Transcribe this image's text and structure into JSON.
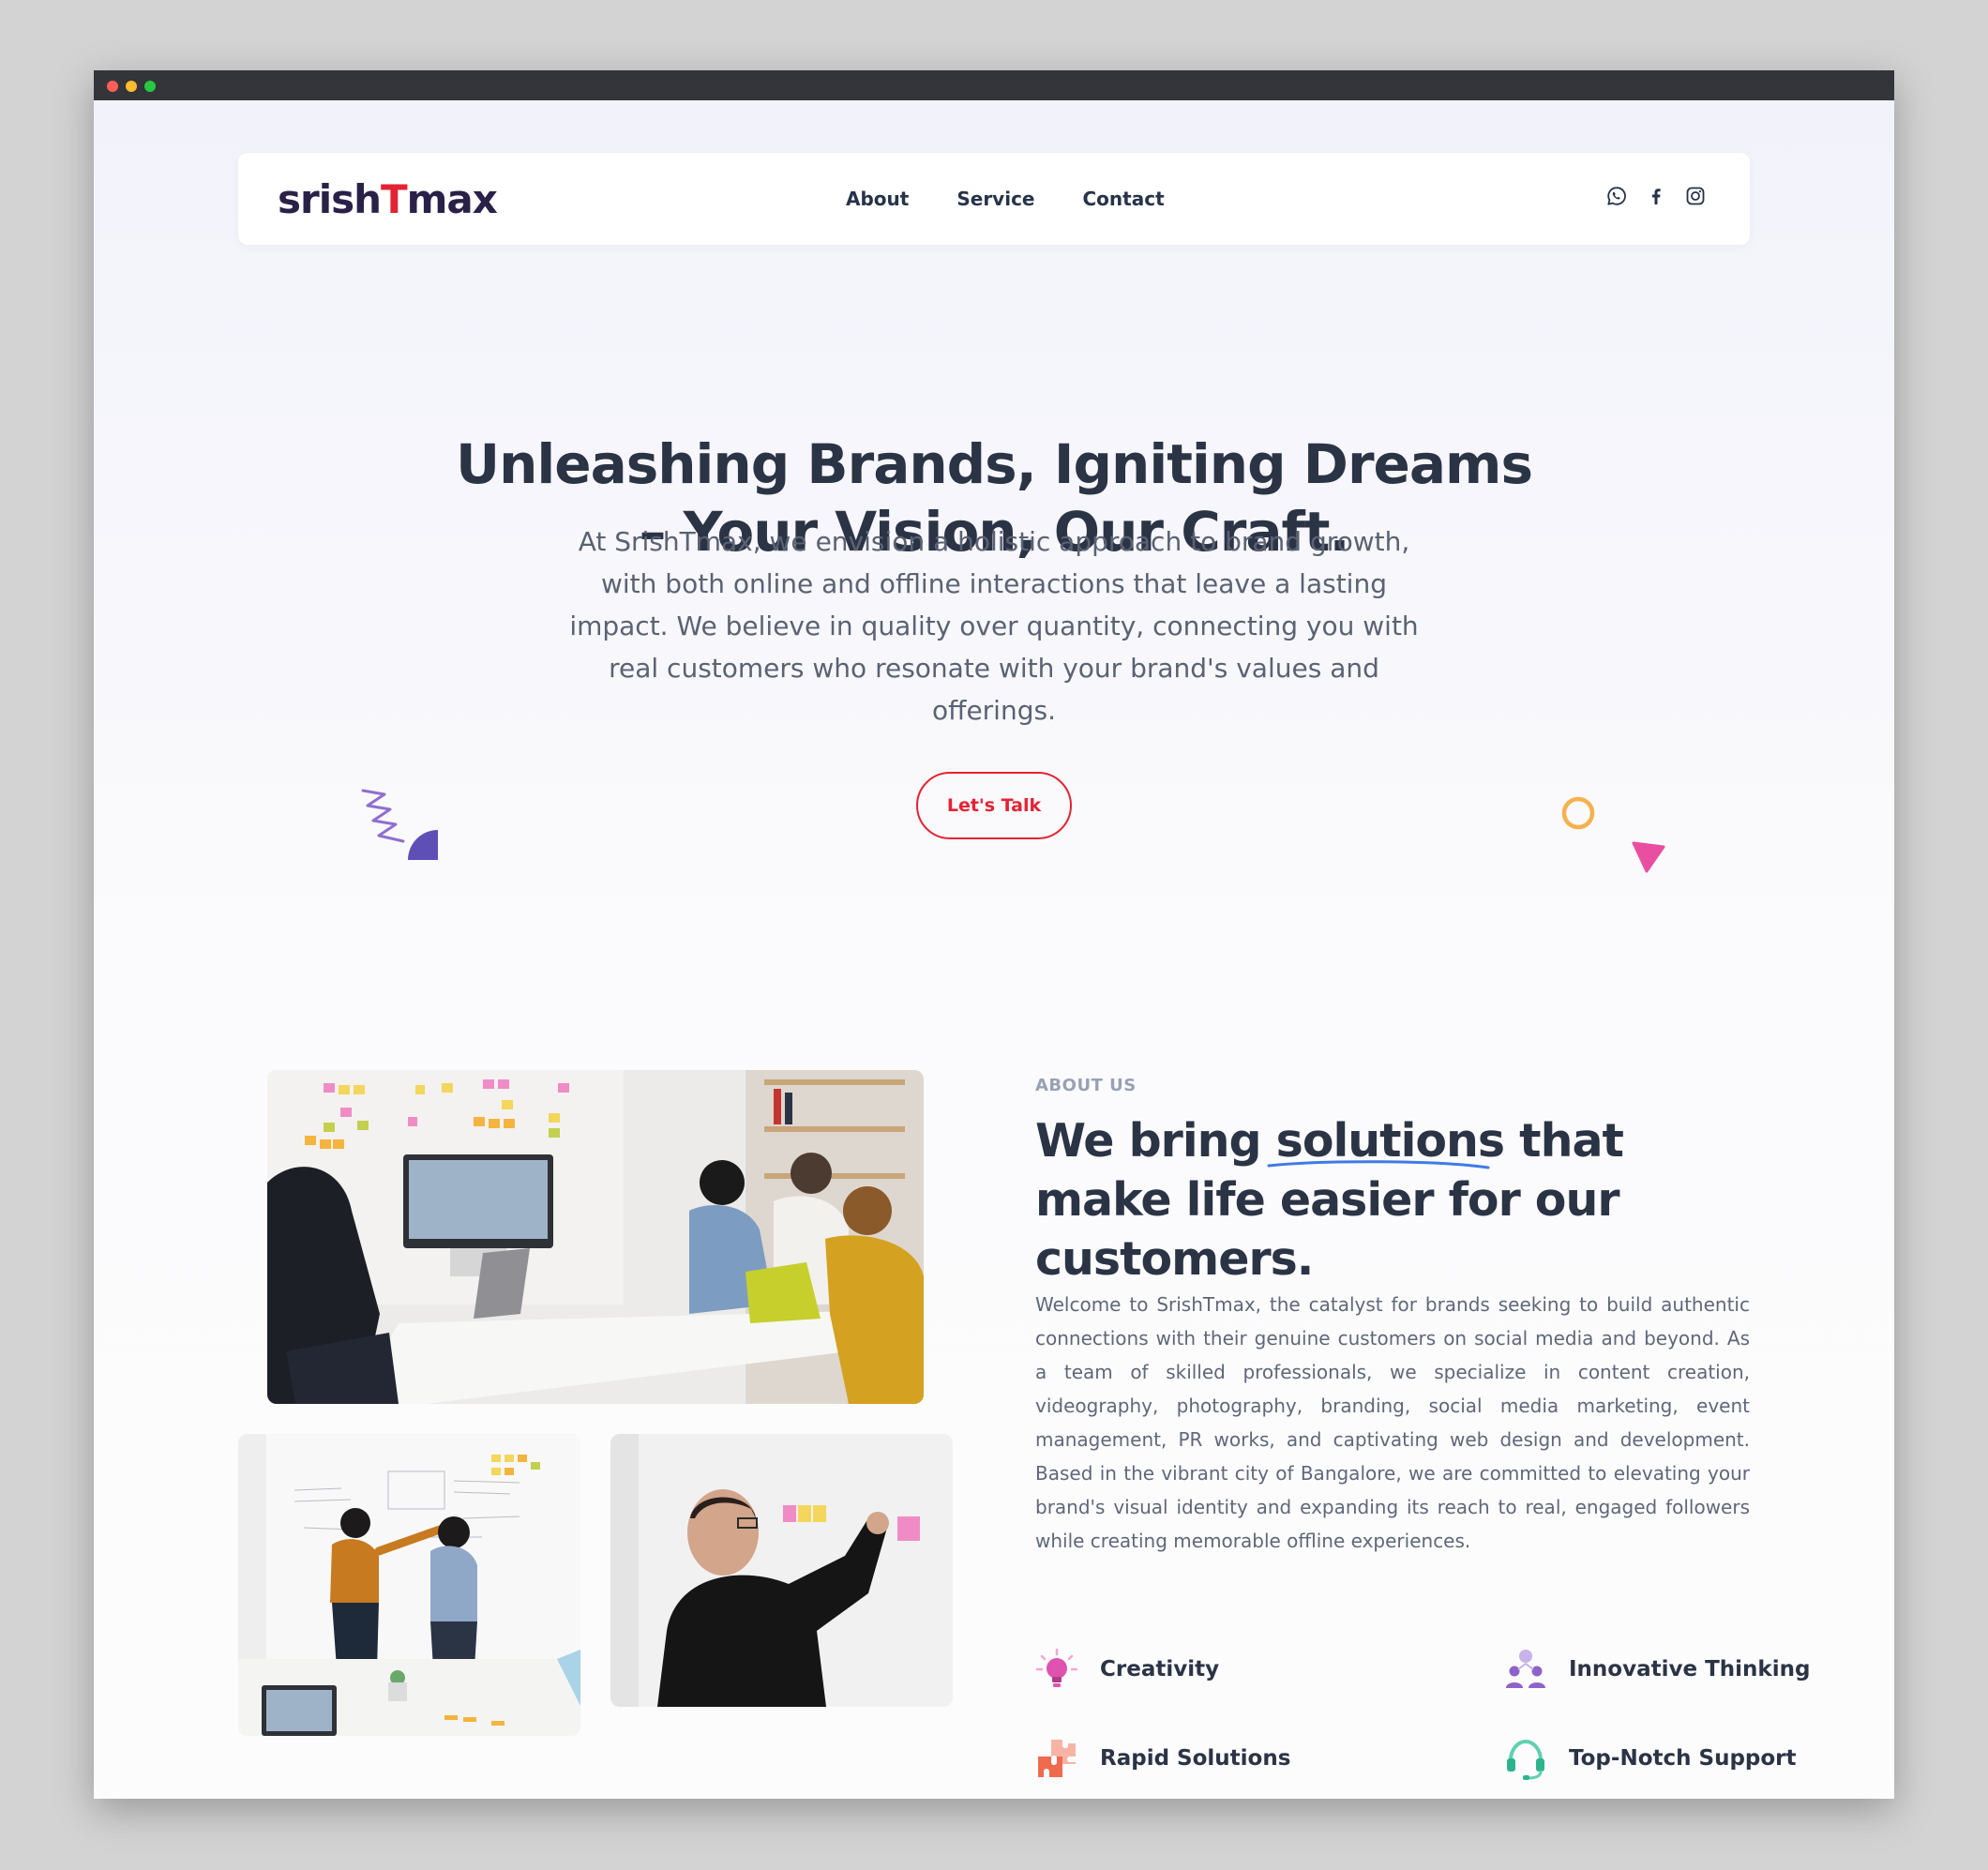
{
  "brand": {
    "logo_pre": "srish",
    "logo_mark": "T",
    "logo_post": "max",
    "accent_color": "#e32333",
    "text_color": "#2b3445"
  },
  "nav": {
    "links": [
      "About",
      "Service",
      "Contact"
    ],
    "socials": [
      "whatsapp-icon",
      "facebook-icon",
      "instagram-icon"
    ]
  },
  "hero": {
    "title_line1": "Unleashing Brands, Igniting Dreams",
    "title_line2": "– Your Vision, Our Craft.",
    "text": "At SrishTmax, we envision a holistic approach to brand growth, with both online and offline interactions that leave a lasting impact. We believe in quality over quantity, connecting you with real customers who resonate with your brand's values and offerings.",
    "cta": "Let's Talk"
  },
  "about": {
    "label": "ABOUT US",
    "title_pre": "We bring",
    "title_highlight": "solutions",
    "title_post": "that make life easier for our customers.",
    "body": "Welcome to SrishTmax, the catalyst for brands seeking to build authentic connections with their genuine customers on social media and beyond. As a team of skilled professionals, we specialize in content creation, videography, photography, branding, social media marketing, event management, PR works, and captivating web design and development. Based in the vibrant city of Bangalore, we are committed to elevating your brand's visual identity and expanding its reach to real, engaged followers while creating memorable offline experiences.",
    "features": [
      {
        "label": "Creativity",
        "icon": "lightbulb-icon"
      },
      {
        "label": "Innovative Thinking",
        "icon": "team-icon"
      },
      {
        "label": "Rapid Solutions",
        "icon": "puzzle-icon"
      },
      {
        "label": "Top-Notch Support",
        "icon": "headset-icon"
      }
    ]
  }
}
